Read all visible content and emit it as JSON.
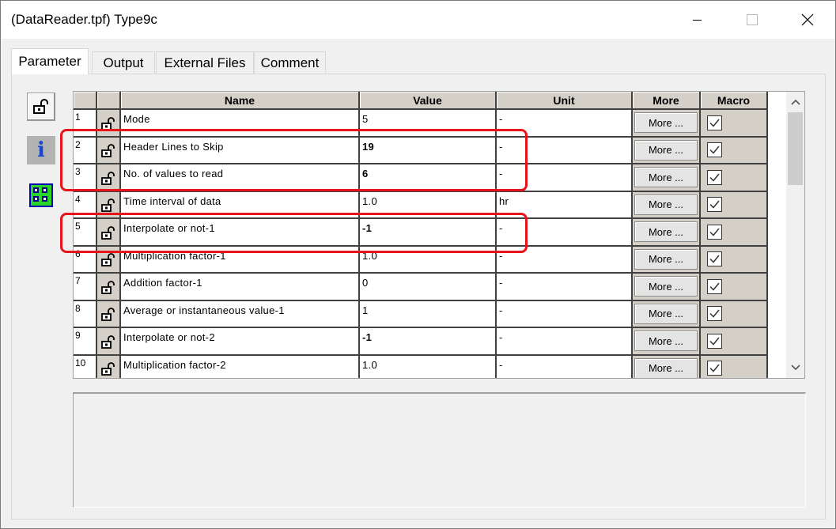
{
  "window": {
    "title": "(DataReader.tpf) Type9c"
  },
  "tabs": [
    {
      "label": "Parameter",
      "active": true
    },
    {
      "label": "Output",
      "active": false
    },
    {
      "label": "External Files",
      "active": false
    },
    {
      "label": "Comment",
      "active": false
    }
  ],
  "grid": {
    "headers": {
      "name": "Name",
      "value": "Value",
      "unit": "Unit",
      "more": "More",
      "macro": "Macro"
    },
    "rows": [
      {
        "num": "1",
        "name": "Mode",
        "value": "5",
        "unit": "-",
        "more": "More ...",
        "macro": true
      },
      {
        "num": "2",
        "name": "Header Lines to Skip",
        "value": "19",
        "unit": "-",
        "more": "More ...",
        "macro": true
      },
      {
        "num": "3",
        "name": "No. of values to read",
        "value": "6",
        "unit": "-",
        "more": "More ...",
        "macro": true
      },
      {
        "num": "4",
        "name": "Time interval of data",
        "value": "1.0",
        "unit": "hr",
        "more": "More ...",
        "macro": true
      },
      {
        "num": "5",
        "name": "Interpolate or not-1",
        "value": "-1",
        "unit": "-",
        "more": "More ...",
        "macro": true
      },
      {
        "num": "6",
        "name": "Multiplication factor-1",
        "value": "1.0",
        "unit": "-",
        "more": "More ...",
        "macro": true
      },
      {
        "num": "7",
        "name": "Addition factor-1",
        "value": "0",
        "unit": "-",
        "more": "More ...",
        "macro": true
      },
      {
        "num": "8",
        "name": "Average or instantaneous value-1",
        "value": "1",
        "unit": "-",
        "more": "More ...",
        "macro": true
      },
      {
        "num": "9",
        "name": "Interpolate or not-2",
        "value": "-1",
        "unit": "-",
        "more": "More ...",
        "macro": true
      },
      {
        "num": "10",
        "name": "Multiplication factor-2",
        "value": "1.0",
        "unit": "-",
        "more": "More ...",
        "macro": true
      }
    ]
  },
  "colors": {
    "highlight": "#e8141c",
    "grid_header": "#d4d0c8"
  },
  "icons": {
    "side_lock": "padlock-icon",
    "side_info": "info-icon",
    "side_chart": "chart-icon",
    "row_lock": "padlock-icon"
  }
}
